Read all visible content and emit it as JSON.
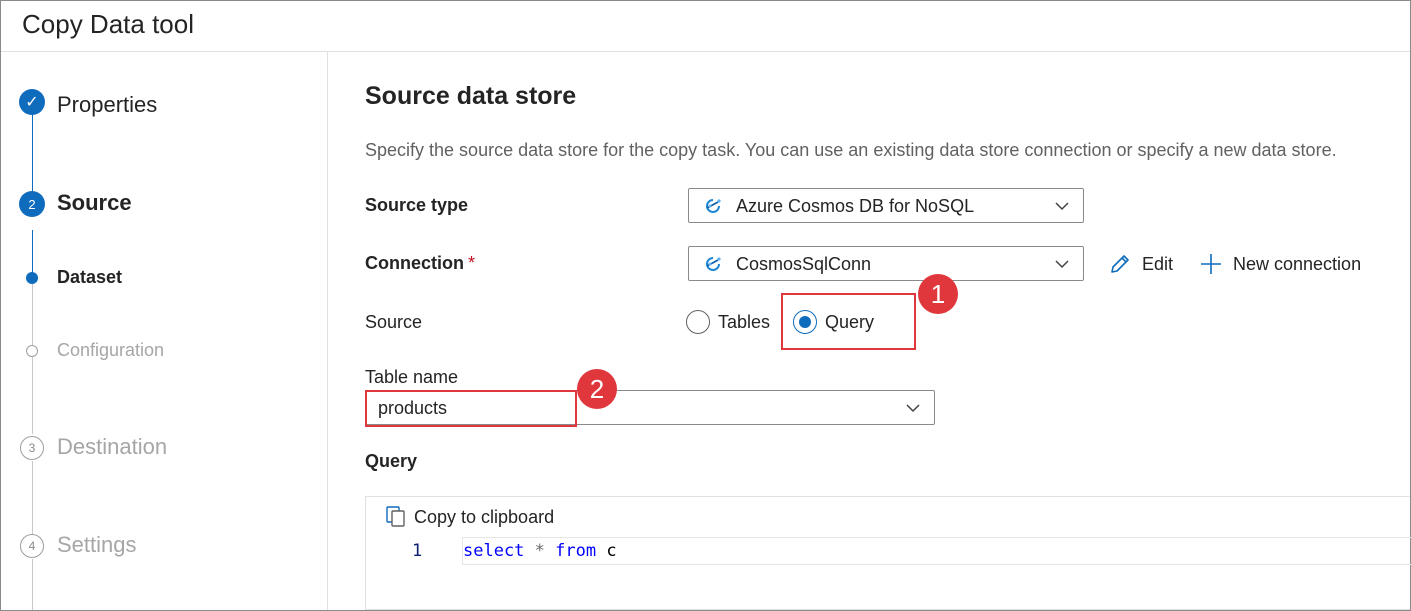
{
  "window": {
    "title": "Copy Data tool"
  },
  "steps": [
    {
      "label": "Properties",
      "marker": "✓",
      "state": "done"
    },
    {
      "label": "Source",
      "marker": "2",
      "state": "active"
    },
    {
      "label": "Dataset",
      "state": "current-substep"
    },
    {
      "label": "Configuration",
      "state": "pending-substep"
    },
    {
      "label": "Destination",
      "marker": "3",
      "state": "pending"
    },
    {
      "label": "Settings",
      "marker": "4",
      "state": "pending"
    }
  ],
  "main": {
    "heading": "Source data store",
    "description": "Specify the source data store for the copy task. You can use an existing data store connection or specify a new data store.",
    "source_type": {
      "label": "Source type",
      "value": "Azure Cosmos DB for NoSQL",
      "icon": "cosmos-db-icon"
    },
    "connection": {
      "label": "Connection",
      "required_mark": "*",
      "value": "CosmosSqlConn",
      "icon": "cosmos-db-icon",
      "edit_label": "Edit",
      "new_label": "New connection"
    },
    "source": {
      "label": "Source",
      "options": [
        {
          "label": "Tables",
          "selected": false
        },
        {
          "label": "Query",
          "selected": true
        }
      ]
    },
    "table_name": {
      "label": "Table name",
      "value": "products"
    },
    "query": {
      "label": "Query",
      "copy_label": "Copy to clipboard",
      "line_number": "1",
      "tokens": {
        "kw1": "select",
        "op": "*",
        "kw2": "from",
        "id": "c"
      }
    }
  },
  "callouts": [
    "1",
    "2"
  ],
  "colors": {
    "accent": "#0f6cbd",
    "callout": "#e0373c",
    "required": "#c50f1f"
  }
}
